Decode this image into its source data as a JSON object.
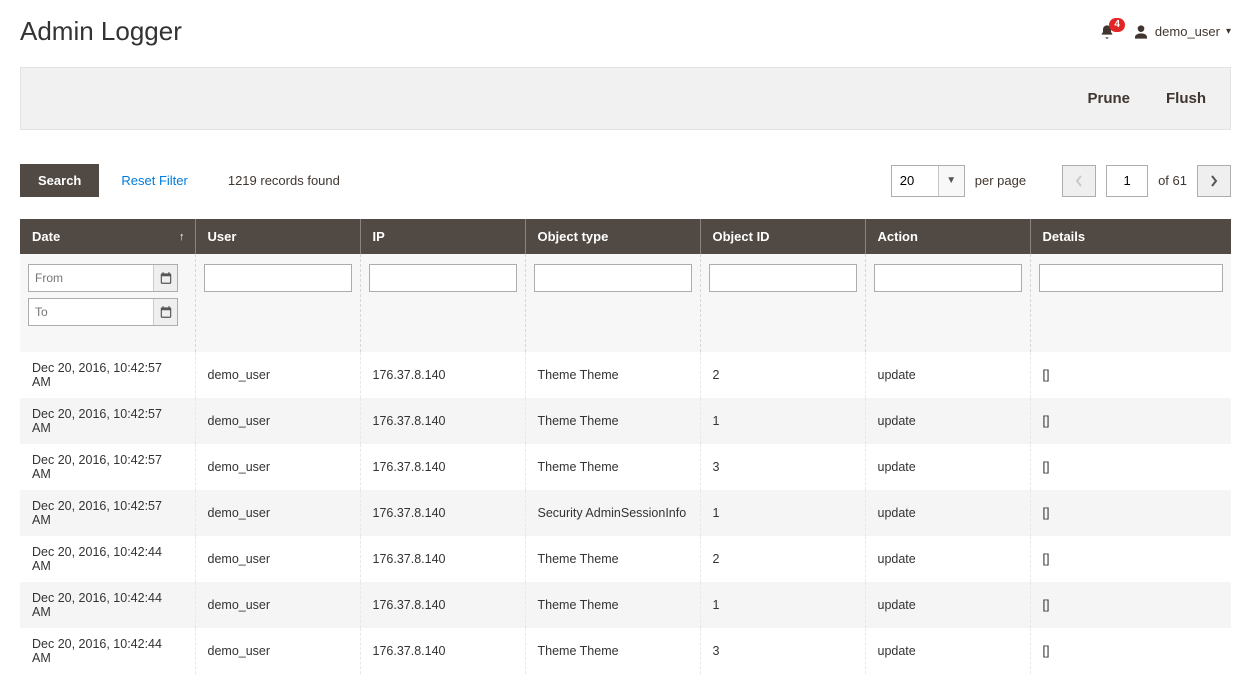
{
  "header": {
    "title": "Admin Logger",
    "notifications_count": "4",
    "username": "demo_user"
  },
  "actionbar": {
    "prune": "Prune",
    "flush": "Flush"
  },
  "tools": {
    "search": "Search",
    "reset": "Reset Filter",
    "records": "1219 records found",
    "per_page_value": "20",
    "per_page_label": "per page",
    "page_current": "1",
    "of_label": "of 61"
  },
  "columns": [
    "Date",
    "User",
    "IP",
    "Object type",
    "Object ID",
    "Action",
    "Details"
  ],
  "filters": {
    "date_from_placeholder": "From",
    "date_to_placeholder": "To"
  },
  "rows": [
    {
      "date": "Dec 20, 2016, 10:42:57 AM",
      "user": "demo_user",
      "ip": "176.37.8.140",
      "otype": "Theme Theme",
      "oid": "2",
      "action": "update",
      "details": "[]"
    },
    {
      "date": "Dec 20, 2016, 10:42:57 AM",
      "user": "demo_user",
      "ip": "176.37.8.140",
      "otype": "Theme Theme",
      "oid": "1",
      "action": "update",
      "details": "[]"
    },
    {
      "date": "Dec 20, 2016, 10:42:57 AM",
      "user": "demo_user",
      "ip": "176.37.8.140",
      "otype": "Theme Theme",
      "oid": "3",
      "action": "update",
      "details": "[]"
    },
    {
      "date": "Dec 20, 2016, 10:42:57 AM",
      "user": "demo_user",
      "ip": "176.37.8.140",
      "otype": "Security AdminSessionInfo",
      "oid": "1",
      "action": "update",
      "details": "[]"
    },
    {
      "date": "Dec 20, 2016, 10:42:44 AM",
      "user": "demo_user",
      "ip": "176.37.8.140",
      "otype": "Theme Theme",
      "oid": "2",
      "action": "update",
      "details": "[]"
    },
    {
      "date": "Dec 20, 2016, 10:42:44 AM",
      "user": "demo_user",
      "ip": "176.37.8.140",
      "otype": "Theme Theme",
      "oid": "1",
      "action": "update",
      "details": "[]"
    },
    {
      "date": "Dec 20, 2016, 10:42:44 AM",
      "user": "demo_user",
      "ip": "176.37.8.140",
      "otype": "Theme Theme",
      "oid": "3",
      "action": "update",
      "details": "[]"
    }
  ]
}
